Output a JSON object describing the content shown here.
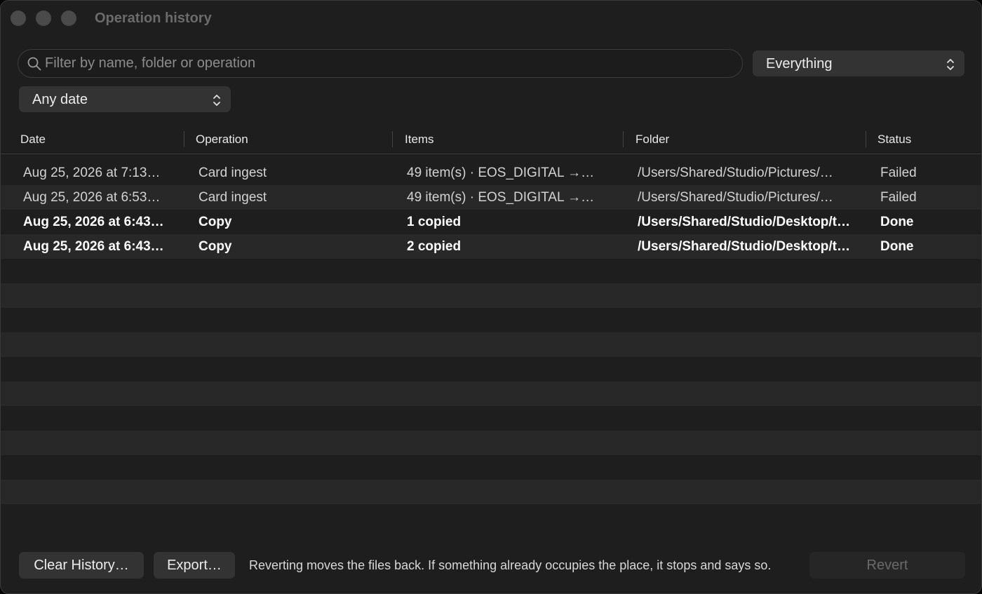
{
  "window": {
    "title": "Operation history"
  },
  "search": {
    "placeholder": "Filter by name, folder or operation",
    "value": ""
  },
  "filters": {
    "type": {
      "selected": "Everything"
    },
    "date": {
      "selected": "Any date"
    }
  },
  "table": {
    "headers": {
      "date": "Date",
      "operation": "Operation",
      "items": "Items",
      "folder": "Folder",
      "status": "Status"
    },
    "rows": [
      {
        "date": "Aug 25, 2026 at 7:13…",
        "operation": "Card ingest",
        "items": "49 item(s) · EOS_DIGITAL →…",
        "folder": "/Users/Shared/Studio/Pictures/…",
        "status": "Failed"
      },
      {
        "date": "Aug 25, 2026 at 6:53…",
        "operation": "Card ingest",
        "items": "49 item(s) · EOS_DIGITAL →…",
        "folder": "/Users/Shared/Studio/Pictures/…",
        "status": "Failed"
      },
      {
        "date": "Aug 25, 2026 at 6:43…",
        "operation": "Copy",
        "items": "1 copied",
        "folder": "/Users/Shared/Studio/Desktop/t…",
        "status": "Done"
      },
      {
        "date": "Aug 25, 2026 at 6:43…",
        "operation": "Copy",
        "items": "2 copied",
        "folder": "/Users/Shared/Studio/Desktop/t…",
        "status": "Done"
      }
    ]
  },
  "footer": {
    "clear_label": "Clear History…",
    "export_label": "Export…",
    "note": "Reverting moves the files back. If something already occupies the place, it stops and says so.",
    "revert_label": "Revert"
  },
  "icons": {
    "search": "search-icon",
    "popup": "chevron-up-down-icon"
  },
  "colors": {
    "window_bg": "#1e1e1e",
    "row_alt": "#282828",
    "control_bg": "#333333"
  }
}
